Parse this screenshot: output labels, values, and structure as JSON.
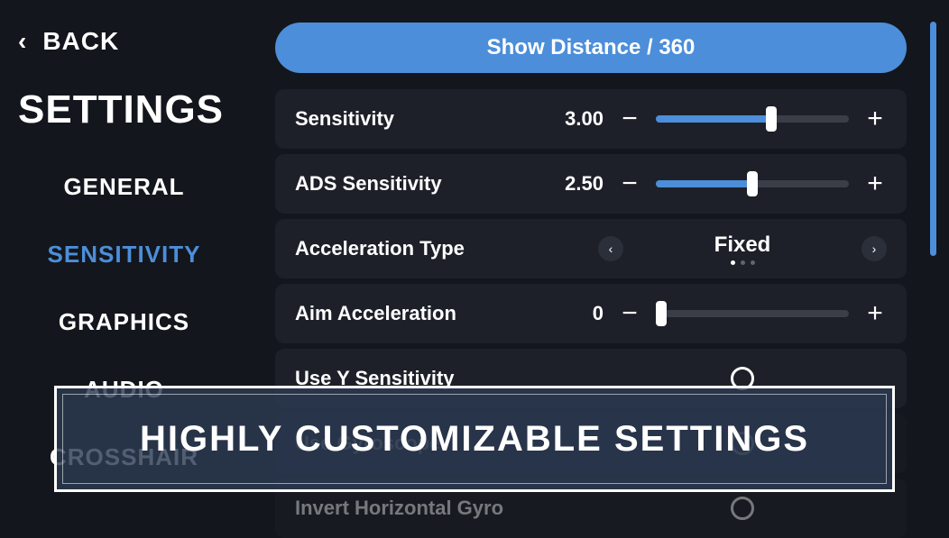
{
  "back_label": "BACK",
  "page_title": "SETTINGS",
  "tabs": {
    "general": "GENERAL",
    "sensitivity": "SENSITIVITY",
    "graphics": "GRAPHICS",
    "audio": "AUDIO",
    "crosshair": "CROSSHAIR"
  },
  "active_tab": "sensitivity",
  "top_button": "Show Distance / 360",
  "settings": {
    "sensitivity": {
      "label": "Sensitivity",
      "value": "3.00",
      "fill_pct": 60
    },
    "ads_sensitivity": {
      "label": "ADS Sensitivity",
      "value": "2.50",
      "fill_pct": 50
    },
    "accel_type": {
      "label": "Acceleration Type",
      "value": "Fixed"
    },
    "aim_accel": {
      "label": "Aim Acceleration",
      "value": "0",
      "fill_pct": 0
    },
    "use_y": {
      "label": "Use Y Sensitivity",
      "checked": false
    },
    "use_gyro": {
      "label": "Use Gyroscope",
      "checked": false
    },
    "invert_h": {
      "label": "Invert Horizontal Gyro",
      "checked": false
    }
  },
  "icons": {
    "minus": "−",
    "plus": "+",
    "chev_left": "‹",
    "chev_right": "›",
    "back_chev": "‹"
  },
  "banner": "HIGHLY CUSTOMIZABLE SETTINGS"
}
